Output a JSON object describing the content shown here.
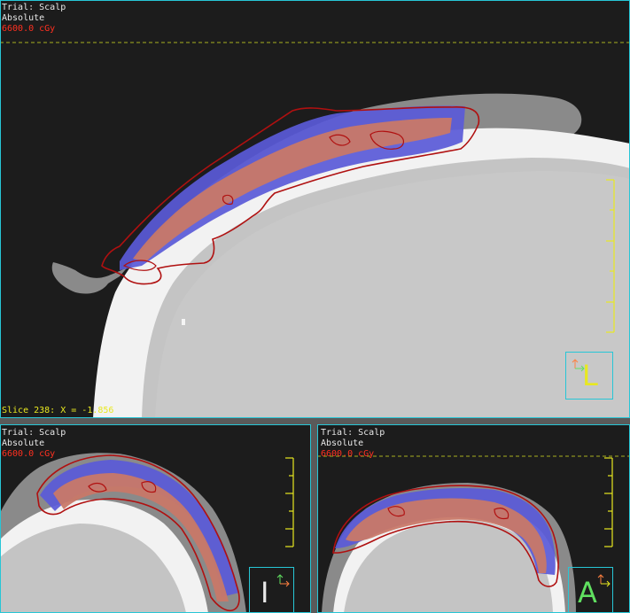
{
  "views": {
    "sagittal": {
      "trial": "Trial: Scalp",
      "mode": "Absolute",
      "dose": "6600.0 cGy",
      "slice": "Slice 238: X = -1.856",
      "orientation": "L",
      "orientation_icon": "sagittal-orientation-icon"
    },
    "axial": {
      "trial": "Trial: Scalp",
      "mode": "Absolute",
      "dose": "6600.0 cGy",
      "orientation": "I",
      "orientation_icon": "axial-orientation-icon"
    },
    "coronal": {
      "trial": "Trial: Scalp",
      "mode": "Absolute",
      "dose": "6600.0 cGy",
      "orientation": "A",
      "orientation_icon": "coronal-orientation-icon"
    }
  },
  "colors": {
    "background": "#1c1c1c",
    "frame": "#27c6d6",
    "dose_line": "#ff3020",
    "contour": "#b01010",
    "ruler": "#e8e820",
    "dose_blue": "#4a4ae6",
    "dose_red": "#d06a5a",
    "text": "#e8e8e8",
    "dashed_line": "#a8b020"
  }
}
